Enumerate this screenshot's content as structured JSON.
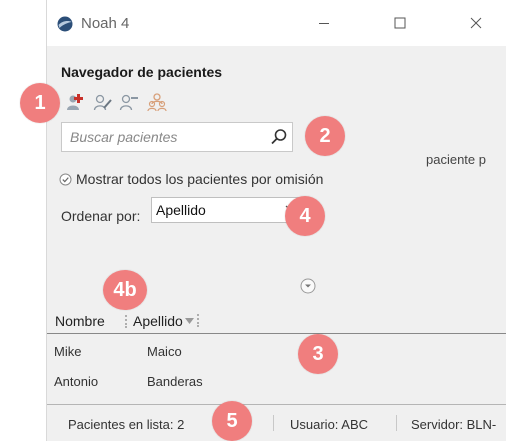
{
  "window": {
    "title": "Noah 4",
    "icons": {
      "app": "noah-globe-icon",
      "minimize": "minimize-icon",
      "maximize": "maximize-icon",
      "close": "close-icon"
    }
  },
  "navigator": {
    "title": "Navegador de pacientes",
    "toolbar": [
      "add-patient-icon",
      "edit-patient-icon",
      "delete-patient-icon",
      "merge-patients-icon"
    ],
    "search": {
      "placeholder": "Buscar pacientes",
      "value": "",
      "icon": "search-icon"
    },
    "side_text": "paciente p",
    "show_all": {
      "label": "Mostrar todos los pacientes por omisión",
      "checked": true
    },
    "sort": {
      "label": "Ordenar por:",
      "value": "Apellido"
    }
  },
  "table": {
    "columns": [
      "Nombre",
      "Apellido"
    ],
    "rows": [
      {
        "nombre": "Mike",
        "apellido": "Maico"
      },
      {
        "nombre": "Antonio",
        "apellido": "Banderas"
      }
    ]
  },
  "status": {
    "patients_count": "Pacientes en lista: 2",
    "user": "Usuario: ABC",
    "server": "Servidor: BLN-"
  },
  "annotations": [
    "1",
    "2",
    "3",
    "4",
    "4b",
    "5"
  ],
  "colors": {
    "badge": "#f07e7e",
    "window_bg": "#f0f0f0",
    "add_icon_red": "#c8312a"
  }
}
